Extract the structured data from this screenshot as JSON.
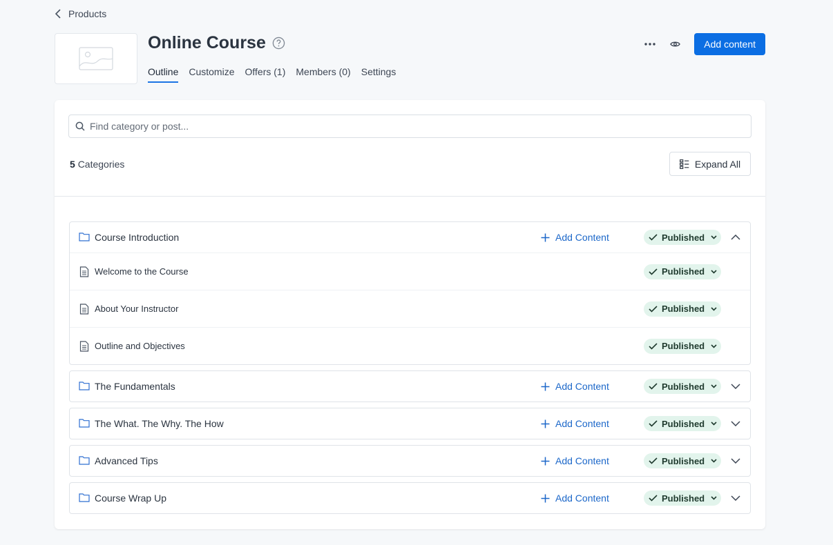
{
  "breadcrumb": {
    "back_label": "Products"
  },
  "product": {
    "title": "Online Course"
  },
  "tabs": [
    {
      "label": "Outline",
      "active": true
    },
    {
      "label": "Customize"
    },
    {
      "label": "Offers (1)"
    },
    {
      "label": "Members (0)"
    },
    {
      "label": "Settings"
    }
  ],
  "actions": {
    "primary_label": "Add content"
  },
  "search": {
    "placeholder": "Find category or post..."
  },
  "summary": {
    "count": "5",
    "count_label": "Categories",
    "expand_label": "Expand All"
  },
  "categories": [
    {
      "name": "Course Introduction",
      "add_label": "Add Content",
      "status": "Published",
      "expanded": true,
      "posts": [
        {
          "name": "Welcome to the Course",
          "status": "Published"
        },
        {
          "name": "About Your Instructor",
          "status": "Published"
        },
        {
          "name": "Outline and Objectives",
          "status": "Published"
        }
      ]
    },
    {
      "name": "The Fundamentals",
      "add_label": "Add Content",
      "status": "Published",
      "expanded": false
    },
    {
      "name": "The What. The Why. The How",
      "add_label": "Add Content",
      "status": "Published",
      "expanded": false
    },
    {
      "name": "Advanced Tips",
      "add_label": "Add Content",
      "status": "Published",
      "expanded": false
    },
    {
      "name": "Course Wrap Up",
      "add_label": "Add Content",
      "status": "Published",
      "expanded": false
    }
  ],
  "colors": {
    "primary": "#0b6ee3",
    "published_bg": "#e2f4ec",
    "link": "#1b67c9",
    "page_bg": "#f6f8fa"
  }
}
